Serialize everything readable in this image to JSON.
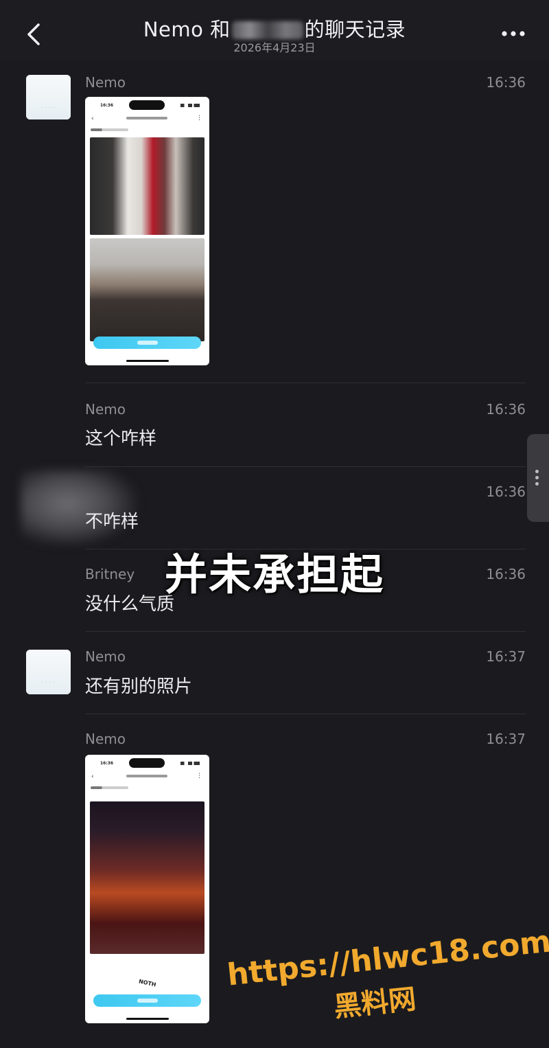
{
  "header": {
    "title_prefix": "Nemo 和",
    "title_suffix": "的聊天记录",
    "date": "2026年4月23日"
  },
  "icons": {
    "back": "chevron-left-icon",
    "more": "more-horizontal-icon",
    "scroll": "vertical-dots-icon"
  },
  "messages": [
    {
      "sender": "Nemo",
      "time": "16:36",
      "type": "image",
      "avatar": true
    },
    {
      "sender": "Nemo",
      "time": "16:36",
      "type": "text",
      "text": "这个咋样"
    },
    {
      "sender": "",
      "time": "16:36",
      "type": "text",
      "text": "不咋样",
      "sender_redacted": true
    },
    {
      "sender": "Britney",
      "time": "16:36",
      "type": "text",
      "text": "没什么气质"
    },
    {
      "sender": "Nemo",
      "time": "16:37",
      "type": "text",
      "text": "还有别的照片",
      "avatar": true
    },
    {
      "sender": "Nemo",
      "time": "16:37",
      "type": "image"
    }
  ],
  "overlay_caption": "并未承担起",
  "watermark": {
    "url": "https://hlwc18.com",
    "name": "黑料网",
    "color": "#f1a92e"
  },
  "phone_shot_2_sign": "NOTH",
  "colors": {
    "background": "#1b1b1f",
    "text": "#ececee",
    "meta": "#8e8e94",
    "button": "#3ec8f0"
  }
}
